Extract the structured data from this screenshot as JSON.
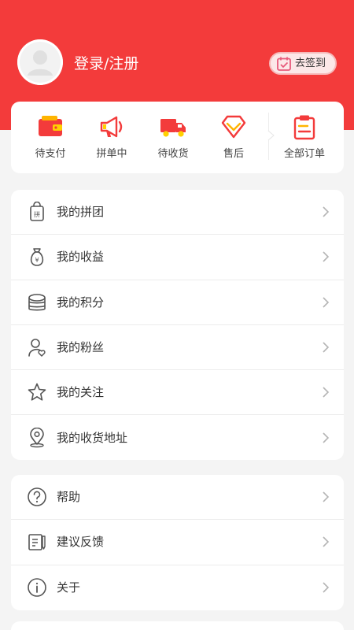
{
  "header": {
    "login_label": "登录/注册",
    "checkin_label": "去签到",
    "background_color": "#f33b3b"
  },
  "orders": {
    "items": [
      {
        "label": "待支付",
        "icon": "wallet-icon"
      },
      {
        "label": "拼单中",
        "icon": "megaphone-icon"
      },
      {
        "label": "待收货",
        "icon": "delivery-truck-icon"
      },
      {
        "label": "售后",
        "icon": "diamond-icon"
      },
      {
        "label": "全部订单",
        "icon": "clipboard-icon"
      }
    ]
  },
  "menu": {
    "group1": [
      {
        "label": "我的拼团",
        "icon": "group-buy-bag-icon"
      },
      {
        "label": "我的收益",
        "icon": "money-bag-icon"
      },
      {
        "label": "我的积分",
        "icon": "coins-stack-icon"
      },
      {
        "label": "我的粉丝",
        "icon": "user-heart-icon"
      },
      {
        "label": "我的关注",
        "icon": "star-icon"
      },
      {
        "label": "我的收货地址",
        "icon": "location-pin-icon"
      }
    ],
    "group2": [
      {
        "label": "帮助",
        "icon": "help-circle-icon"
      },
      {
        "label": "建议反馈",
        "icon": "feedback-icon"
      },
      {
        "label": "关于",
        "icon": "info-circle-icon"
      }
    ]
  },
  "colors": {
    "accent": "#f33b3b",
    "page_bg": "#f4f4f4"
  }
}
